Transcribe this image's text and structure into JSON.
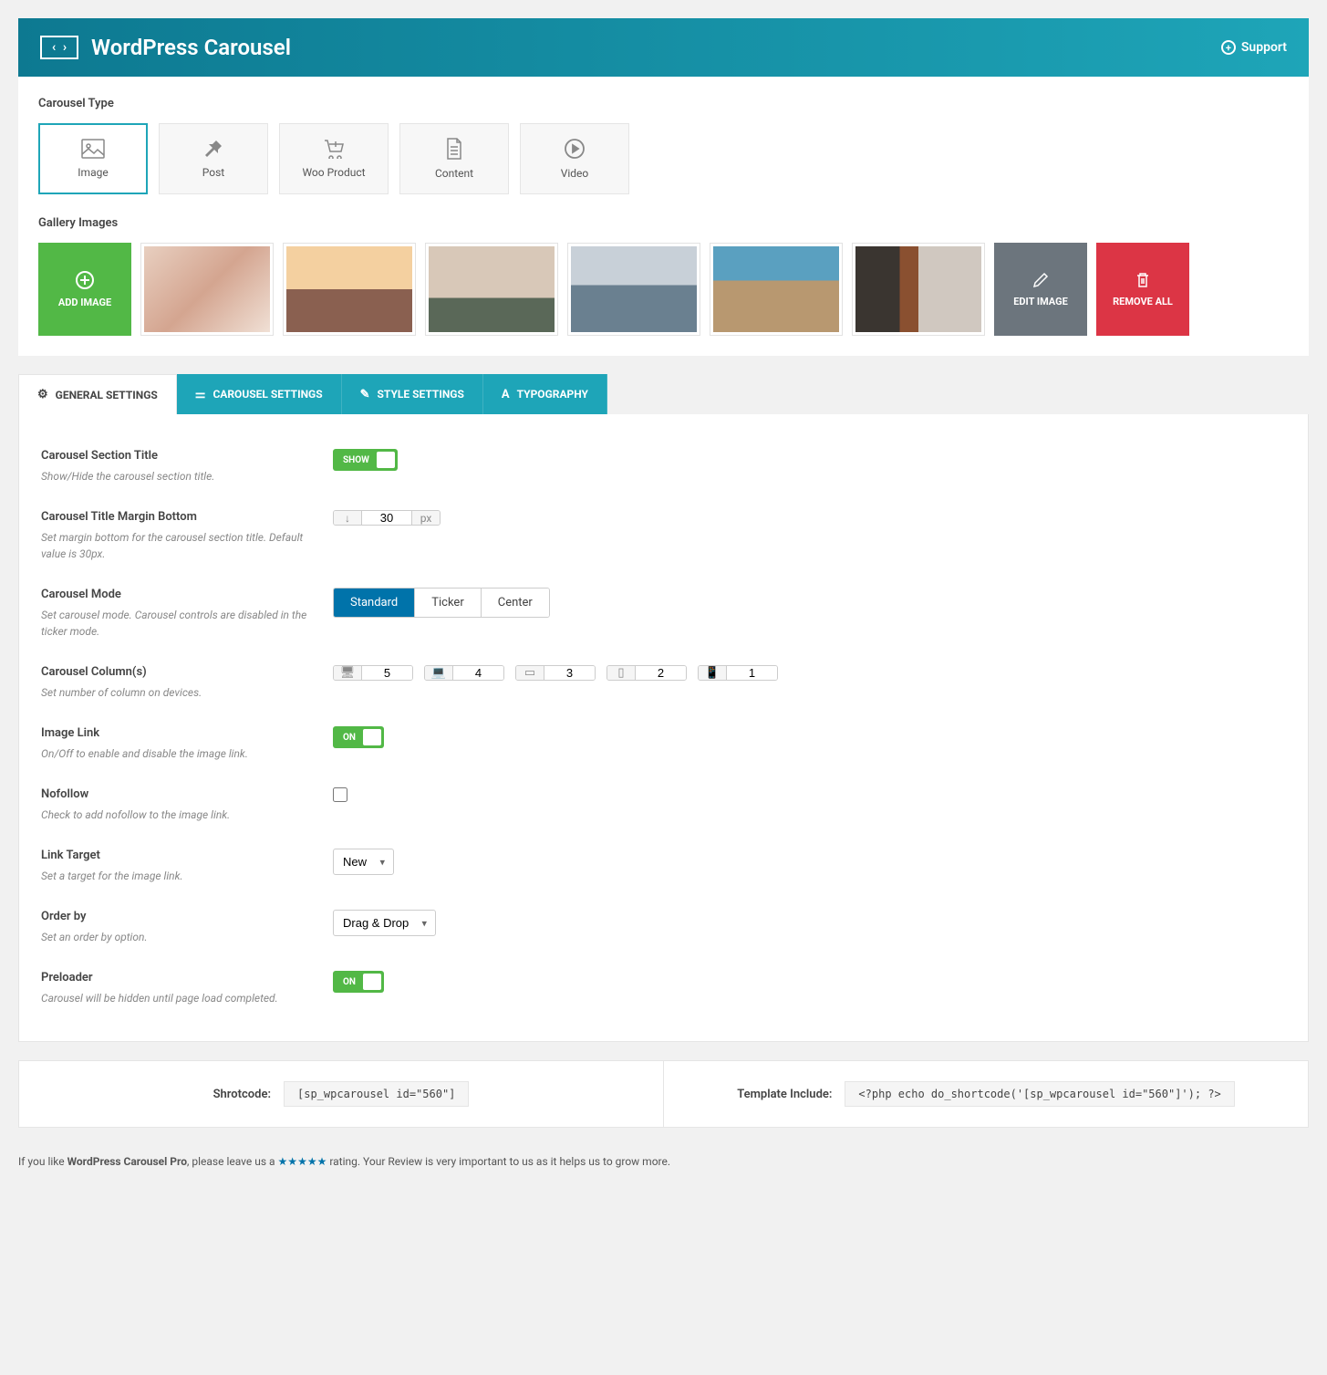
{
  "header": {
    "title": "WordPress Carousel",
    "support": "Support"
  },
  "carousel_type": {
    "label": "Carousel Type",
    "options": [
      "Image",
      "Post",
      "Woo Product",
      "Content",
      "Video"
    ]
  },
  "gallery": {
    "label": "Gallery Images",
    "add": "ADD IMAGE",
    "edit": "EDIT IMAGE",
    "remove": "REMOVE ALL"
  },
  "tabs": [
    "GENERAL SETTINGS",
    "CAROUSEL SETTINGS",
    "STYLE SETTINGS",
    "TYPOGRAPHY"
  ],
  "fields": {
    "section_title": {
      "label": "Carousel Section Title",
      "desc": "Show/Hide the carousel section title.",
      "toggle": "SHOW"
    },
    "margin_bottom": {
      "label": "Carousel Title Margin Bottom",
      "desc": "Set margin bottom for the carousel section title. Default value is 30px.",
      "value": "30",
      "unit": "px"
    },
    "mode": {
      "label": "Carousel Mode",
      "desc": "Set carousel mode. Carousel controls are disabled in the ticker mode.",
      "options": [
        "Standard",
        "Ticker",
        "Center"
      ]
    },
    "columns": {
      "label": "Carousel Column(s)",
      "desc": "Set number of column on devices.",
      "values": [
        "5",
        "4",
        "3",
        "2",
        "1"
      ]
    },
    "image_link": {
      "label": "Image Link",
      "desc": "On/Off to enable and disable the image link.",
      "toggle": "ON"
    },
    "nofollow": {
      "label": "Nofollow",
      "desc": "Check to add nofollow to the image link."
    },
    "link_target": {
      "label": "Link Target",
      "desc": "Set a target for the image link.",
      "value": "New"
    },
    "order_by": {
      "label": "Order by",
      "desc": "Set an order by option.",
      "value": "Drag & Drop"
    },
    "preloader": {
      "label": "Preloader",
      "desc": "Carousel will be hidden until page load completed.",
      "toggle": "ON"
    }
  },
  "bottom": {
    "shortcode_label": "Shrotcode:",
    "shortcode_value": "[sp_wpcarousel id=\"560\"]",
    "template_label": "Template Include:",
    "template_value": "<?php echo do_shortcode('[sp_wpcarousel id=\"560\"]'); ?>"
  },
  "footer": {
    "pre": "If you like ",
    "bold": "WordPress Carousel Pro",
    "mid": ", please leave us a ",
    "stars": "★★★★★",
    "post": " rating. Your Review is very important to us as it helps us to grow more."
  }
}
